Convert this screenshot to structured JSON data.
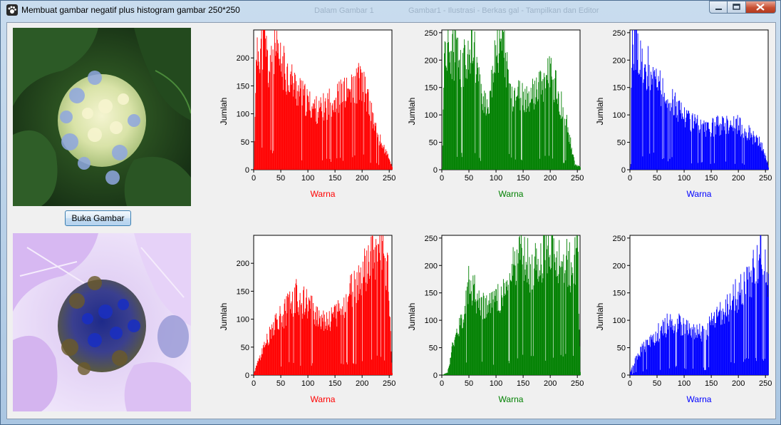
{
  "window": {
    "title": "Membuat gambar negatif plus histogram gambar 250*250",
    "background_titles": [
      "Dalam Gambar 1",
      "Gambar1 - Ilustrasi - Berkas gal - Tampilkan dan Editor"
    ]
  },
  "button": {
    "label": "Buka Gambar"
  },
  "images": {
    "original": "hydrangea-photo",
    "negative": "hydrangea-negative-photo"
  },
  "chart_data": [
    {
      "type": "bar",
      "panel": "original-red",
      "color": "#ff0000",
      "xlabel": "Warna",
      "ylabel": "Jumlah",
      "xlim": [
        0,
        255
      ],
      "ylim": [
        0,
        250
      ],
      "xticks": [
        0,
        50,
        100,
        150,
        200,
        250
      ],
      "yticks": [
        0,
        50,
        100,
        150,
        200
      ],
      "profile": [
        [
          0,
          5
        ],
        [
          3,
          170
        ],
        [
          8,
          230
        ],
        [
          15,
          240
        ],
        [
          22,
          236
        ],
        [
          27,
          180
        ],
        [
          35,
          232
        ],
        [
          45,
          205
        ],
        [
          60,
          185
        ],
        [
          80,
          150
        ],
        [
          100,
          125
        ],
        [
          120,
          110
        ],
        [
          140,
          128
        ],
        [
          160,
          140
        ],
        [
          180,
          148
        ],
        [
          195,
          170
        ],
        [
          205,
          150
        ],
        [
          215,
          110
        ],
        [
          230,
          60
        ],
        [
          245,
          30
        ],
        [
          255,
          5
        ]
      ]
    },
    {
      "type": "bar",
      "panel": "original-green",
      "color": "#008000",
      "xlabel": "Warna",
      "ylabel": "Jumlah",
      "xlim": [
        0,
        255
      ],
      "ylim": [
        0,
        255
      ],
      "xticks": [
        0,
        50,
        100,
        150,
        200,
        250
      ],
      "yticks": [
        0,
        50,
        100,
        150,
        200,
        250
      ],
      "profile": [
        [
          0,
          5
        ],
        [
          5,
          240
        ],
        [
          12,
          230
        ],
        [
          25,
          220
        ],
        [
          40,
          200
        ],
        [
          55,
          250
        ],
        [
          70,
          150
        ],
        [
          85,
          120
        ],
        [
          100,
          245
        ],
        [
          115,
          225
        ],
        [
          130,
          140
        ],
        [
          145,
          140
        ],
        [
          160,
          135
        ],
        [
          175,
          150
        ],
        [
          190,
          170
        ],
        [
          200,
          190
        ],
        [
          215,
          140
        ],
        [
          230,
          90
        ],
        [
          245,
          10
        ],
        [
          255,
          5
        ]
      ]
    },
    {
      "type": "bar",
      "panel": "original-blue",
      "color": "#0000ff",
      "xlabel": "Warna",
      "ylabel": "Jumlah",
      "xlim": [
        0,
        255
      ],
      "ylim": [
        0,
        255
      ],
      "xticks": [
        0,
        50,
        100,
        150,
        200,
        250
      ],
      "yticks": [
        0,
        50,
        100,
        150,
        200,
        250
      ],
      "profile": [
        [
          0,
          5
        ],
        [
          3,
          235
        ],
        [
          8,
          245
        ],
        [
          15,
          220
        ],
        [
          25,
          205
        ],
        [
          35,
          195
        ],
        [
          45,
          175
        ],
        [
          60,
          145
        ],
        [
          80,
          130
        ],
        [
          100,
          105
        ],
        [
          120,
          90
        ],
        [
          140,
          75
        ],
        [
          160,
          85
        ],
        [
          180,
          90
        ],
        [
          200,
          85
        ],
        [
          220,
          70
        ],
        [
          240,
          50
        ],
        [
          250,
          25
        ],
        [
          255,
          5
        ]
      ]
    },
    {
      "type": "bar",
      "panel": "negative-red",
      "color": "#ff0000",
      "xlabel": "Warna",
      "ylabel": "Jumlah",
      "xlim": [
        0,
        255
      ],
      "ylim": [
        0,
        250
      ],
      "xticks": [
        0,
        50,
        100,
        150,
        200,
        250
      ],
      "yticks": [
        0,
        50,
        100,
        150,
        200
      ],
      "profile": [
        [
          0,
          5
        ],
        [
          10,
          30
        ],
        [
          25,
          70
        ],
        [
          40,
          100
        ],
        [
          55,
          115
        ],
        [
          75,
          150
        ],
        [
          95,
          135
        ],
        [
          115,
          115
        ],
        [
          135,
          105
        ],
        [
          155,
          115
        ],
        [
          175,
          150
        ],
        [
          195,
          180
        ],
        [
          210,
          205
        ],
        [
          220,
          225
        ],
        [
          230,
          240
        ],
        [
          240,
          236
        ],
        [
          248,
          180
        ],
        [
          255,
          5
        ]
      ]
    },
    {
      "type": "bar",
      "panel": "negative-green",
      "color": "#008000",
      "xlabel": "Warna",
      "ylabel": "Jumlah",
      "xlim": [
        0,
        255
      ],
      "ylim": [
        0,
        255
      ],
      "xticks": [
        0,
        50,
        100,
        150,
        200,
        250
      ],
      "yticks": [
        0,
        50,
        100,
        150,
        200,
        250
      ],
      "profile": [
        [
          0,
          0
        ],
        [
          10,
          5
        ],
        [
          20,
          60
        ],
        [
          35,
          100
        ],
        [
          50,
          185
        ],
        [
          65,
          150
        ],
        [
          80,
          135
        ],
        [
          95,
          135
        ],
        [
          110,
          150
        ],
        [
          125,
          185
        ],
        [
          140,
          230
        ],
        [
          150,
          240
        ],
        [
          165,
          200
        ],
        [
          180,
          225
        ],
        [
          195,
          245
        ],
        [
          210,
          220
        ],
        [
          225,
          230
        ],
        [
          240,
          200
        ],
        [
          250,
          245
        ],
        [
          255,
          5
        ]
      ]
    },
    {
      "type": "bar",
      "panel": "negative-blue",
      "color": "#0000ff",
      "xlabel": "Warna",
      "ylabel": "Jumlah",
      "xlim": [
        0,
        255
      ],
      "ylim": [
        0,
        255
      ],
      "xticks": [
        0,
        50,
        100,
        150,
        200,
        250
      ],
      "yticks": [
        0,
        50,
        100,
        150,
        200,
        250
      ],
      "profile": [
        [
          0,
          5
        ],
        [
          10,
          35
        ],
        [
          25,
          55
        ],
        [
          40,
          70
        ],
        [
          60,
          90
        ],
        [
          80,
          105
        ],
        [
          100,
          90
        ],
        [
          120,
          80
        ],
        [
          140,
          85
        ],
        [
          160,
          110
        ],
        [
          180,
          130
        ],
        [
          200,
          160
        ],
        [
          215,
          185
        ],
        [
          230,
          200
        ],
        [
          240,
          245
        ],
        [
          248,
          220
        ],
        [
          255,
          175
        ]
      ]
    }
  ]
}
